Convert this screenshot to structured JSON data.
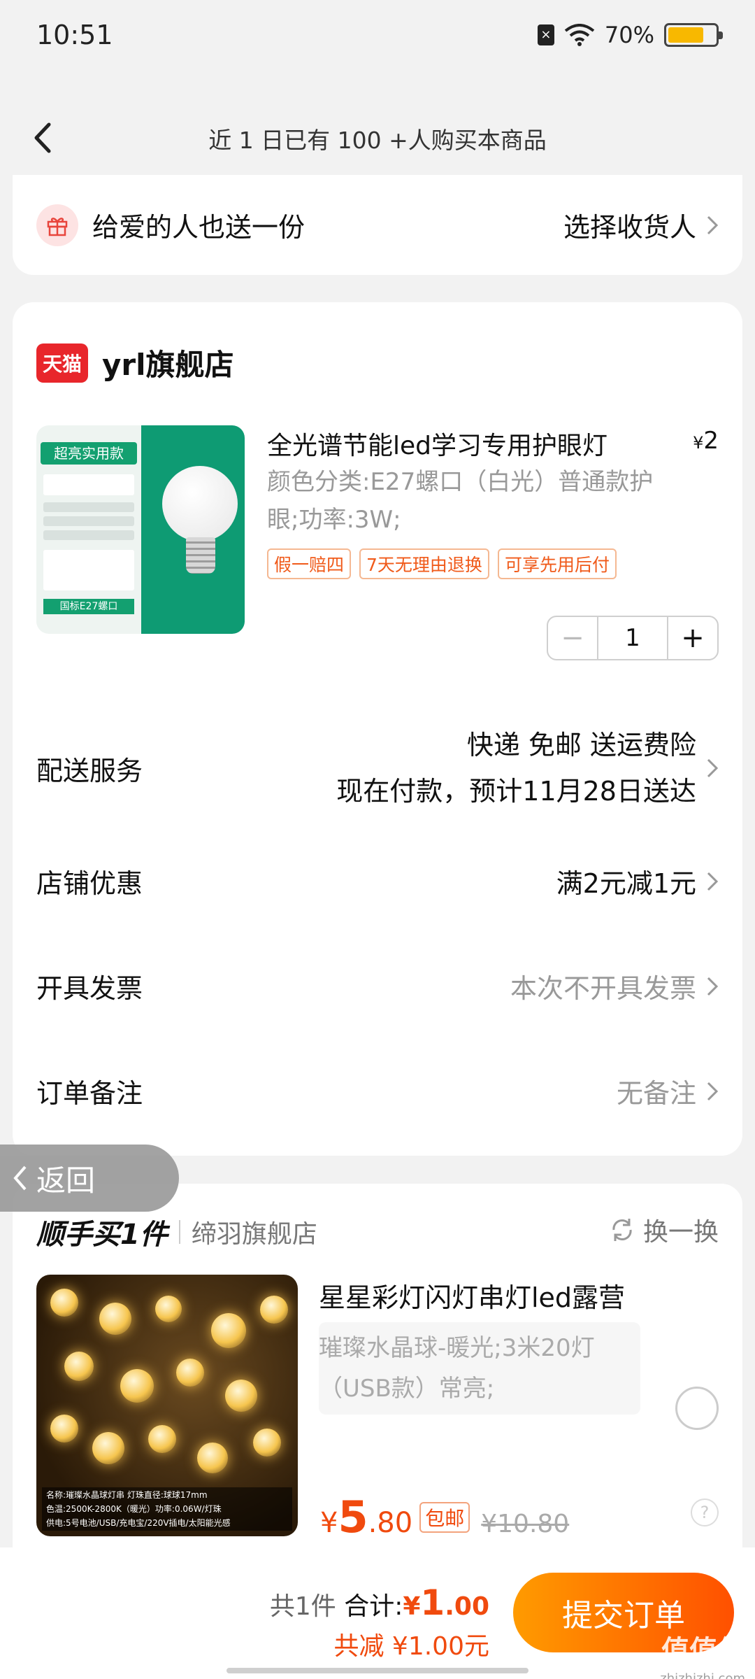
{
  "status_bar": {
    "time": "10:51",
    "battery": "70%"
  },
  "nav": {
    "title": "近 1 日已有 100 +人购买本商品"
  },
  "gift": {
    "label": "给爱的人也送一份",
    "action": "选择收货人"
  },
  "shop": {
    "logo_text": "天猫",
    "name": "yrl旗舰店"
  },
  "product": {
    "title": "全光谱节能led学习专用护眼灯",
    "price_symbol": "¥",
    "price": "2",
    "spec": "颜色分类:E27螺口（白光）普通款护眼;功率:3W;",
    "tags": [
      "假一赔四",
      "7天无理由退换",
      "可享先用后付"
    ],
    "quantity": "1",
    "image_badge": "超亮实用款",
    "image_bottom": "国标E27螺口"
  },
  "delivery": {
    "label": "配送服务",
    "line1": "快递 免邮 送运费险",
    "line2": "现在付款，预计11月28日送达"
  },
  "shop_discount": {
    "label": "店铺优惠",
    "value": "满2元减1元"
  },
  "invoice": {
    "label": "开具发票",
    "value": "本次不开具发票"
  },
  "note": {
    "label": "订单备注",
    "value": "无备注"
  },
  "back_pill": {
    "label": "返回"
  },
  "suggest": {
    "title": "顺手买1件",
    "shop": "缔羽旗舰店",
    "swap": "换一换",
    "name": "星星彩灯闪灯串灯led露营",
    "spec": "璀璨水晶球-暖光;3米20灯（USB款）常亮;",
    "price_symbol": "¥",
    "price_int": "5",
    "price_dec": ".80",
    "free_ship": "包邮",
    "orig_price": "¥10.80",
    "caption1": "名称:璀璨水晶球灯串    灯珠直径:球球17mm",
    "caption2": "色温:2500K-2800K（暖光）功率:0.06W/灯珠",
    "caption3": "供电:5号电池/USB/充电宝/220V插电/太阳能光感"
  },
  "summary": {
    "count": "共1件",
    "total_label": "合计:",
    "total_symbol": "¥",
    "total_int": "1",
    "total_dec": ".00",
    "saved": "共减 ¥1.00元"
  },
  "submit": {
    "label": "提交订单"
  },
  "watermark": {
    "text": "值值值",
    "url": "zhizhizhi.com"
  },
  "colors": {
    "accent": "#ff5000",
    "price": "#f04a0e",
    "tmall": "#e8262b"
  }
}
